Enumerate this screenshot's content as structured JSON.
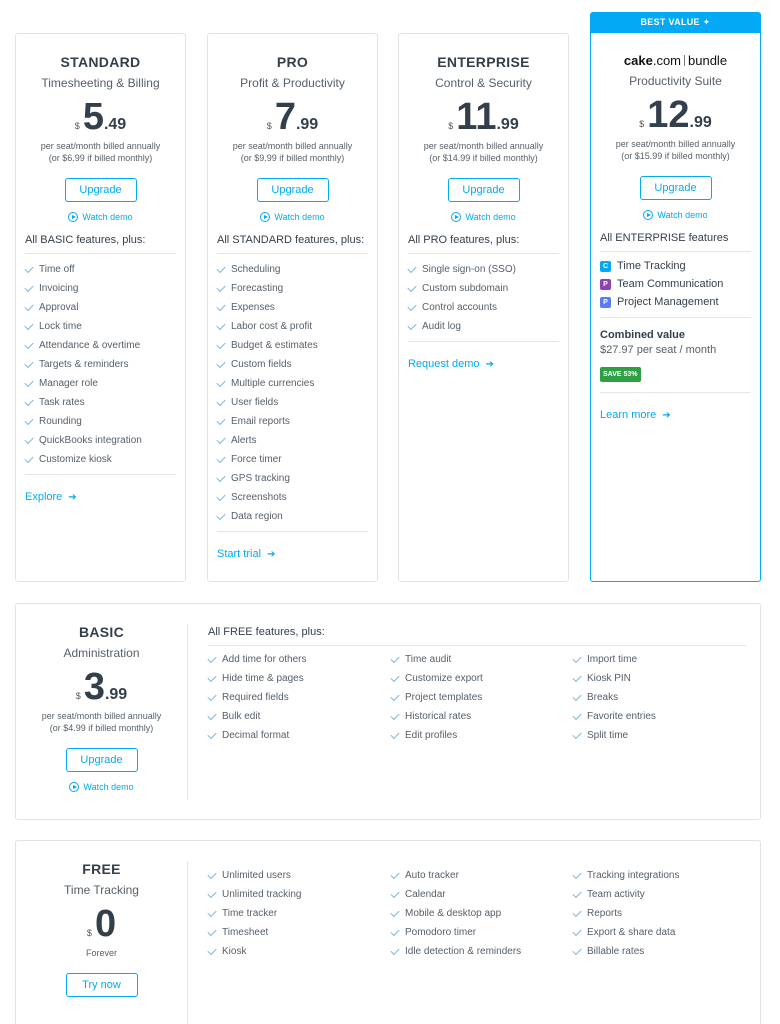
{
  "plans": [
    {
      "name": "STANDARD",
      "subtitle": "Timesheeting & Billing",
      "currency": "$",
      "price_int": "5",
      "price_dec": ".49",
      "billing_1": "per seat/month billed annually",
      "billing_2": "(or $6.99 if billed monthly)",
      "cta": "Upgrade",
      "demo": "Watch demo",
      "features_head": "All BASIC features, plus:",
      "features": [
        "Time off",
        "Invoicing",
        "Approval",
        "Lock time",
        "Attendance & overtime",
        "Targets & reminders",
        "Manager role",
        "Task rates",
        "Rounding",
        "QuickBooks integration",
        "Customize kiosk"
      ],
      "link": "Explore"
    },
    {
      "name": "PRO",
      "subtitle": "Profit & Productivity",
      "currency": "$",
      "price_int": "7",
      "price_dec": ".99",
      "billing_1": "per seat/month billed annually",
      "billing_2": "(or $9.99 if billed monthly)",
      "cta": "Upgrade",
      "demo": "Watch demo",
      "features_head": "All STANDARD features, plus:",
      "features": [
        "Scheduling",
        "Forecasting",
        "Expenses",
        "Labor cost & profit",
        "Budget & estimates",
        "Custom fields",
        "Multiple currencies",
        "User fields",
        "Email reports",
        "Alerts",
        "Force timer",
        "GPS tracking",
        "Screenshots",
        "Data region"
      ],
      "link": "Start trial"
    },
    {
      "name": "ENTERPRISE",
      "subtitle": "Control & Security",
      "currency": "$",
      "price_int": "11",
      "price_dec": ".99",
      "billing_1": "per seat/month billed annually",
      "billing_2": "(or $14.99 if billed monthly)",
      "cta": "Upgrade",
      "demo": "Watch demo",
      "features_head": "All PRO features, plus:",
      "features": [
        "Single sign-on (SSO)",
        "Custom subdomain",
        "Control accounts",
        "Audit log"
      ],
      "link": "Request demo"
    }
  ],
  "bundle": {
    "tab": "BEST VALUE",
    "logo_a": "cake",
    "logo_b": ".com",
    "logo_c": "bundle",
    "subtitle": "Productivity Suite",
    "currency": "$",
    "price_int": "12",
    "price_dec": ".99",
    "billing_1": "per seat/month billed annually",
    "billing_2": "(or $15.99 if billed monthly)",
    "cta": "Upgrade",
    "demo": "Watch demo",
    "features_head": "All ENTERPRISE features",
    "products": [
      {
        "label": "Time Tracking",
        "color": "#03a9f4",
        "glyph": "C"
      },
      {
        "label": "Team Communication",
        "color": "#8e44ad",
        "glyph": "P"
      },
      {
        "label": "Project Management",
        "color": "#5b7cf0",
        "glyph": "P"
      }
    ],
    "combined_title": "Combined value",
    "combined_value": "$27.97 per seat / month",
    "save_badge": "SAVE 53%",
    "link": "Learn more"
  },
  "basic": {
    "name": "BASIC",
    "subtitle": "Administration",
    "currency": "$",
    "price_int": "3",
    "price_dec": ".99",
    "billing_1": "per seat/month billed annually",
    "billing_2": "(or $4.99 if billed monthly)",
    "cta": "Upgrade",
    "demo": "Watch demo",
    "features_head": "All FREE features, plus:",
    "col1": [
      "Add time for others",
      "Hide time & pages",
      "Required fields",
      "Bulk edit",
      "Decimal format"
    ],
    "col2": [
      "Time audit",
      "Customize export",
      "Project templates",
      "Historical rates",
      "Edit profiles"
    ],
    "col3": [
      "Import time",
      "Kiosk PIN",
      "Breaks",
      "Favorite entries",
      "Split time"
    ]
  },
  "free": {
    "name": "FREE",
    "subtitle": "Time Tracking",
    "currency": "$",
    "price_int": "0",
    "forever": "Forever",
    "cta": "Try now",
    "col1": [
      "Unlimited users",
      "Unlimited tracking",
      "Time tracker",
      "Timesheet",
      "Kiosk"
    ],
    "col2": [
      "Auto tracker",
      "Calendar",
      "Mobile & desktop app",
      "Pomodoro timer",
      "Idle detection & reminders"
    ],
    "col3": [
      "Tracking integrations",
      "Team activity",
      "Reports",
      "Export & share data",
      "Billable rates"
    ]
  },
  "colors": {
    "accent": "#03a9f4",
    "save_green": "#2ea043"
  },
  "icons": [
    "check-icon",
    "play-icon",
    "arrow-right-icon",
    "sparkle-icon"
  ]
}
